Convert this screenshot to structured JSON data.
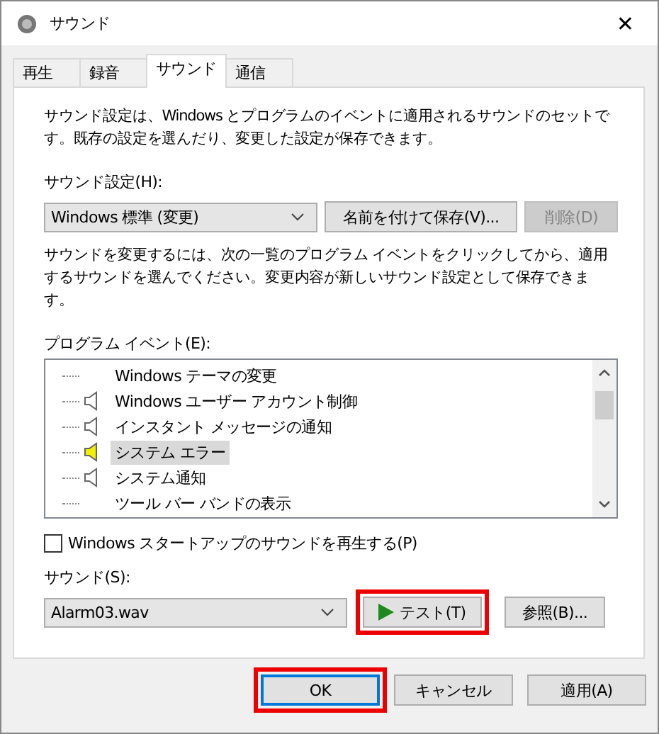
{
  "window": {
    "title": "サウンド",
    "close": "✕"
  },
  "tabs": [
    {
      "label": "再生",
      "selected": false
    },
    {
      "label": "録音",
      "selected": false
    },
    {
      "label": "サウンド",
      "selected": true
    },
    {
      "label": "通信",
      "selected": false
    }
  ],
  "intro": "サウンド設定は、Windows とプログラムのイベントに適用されるサウンドのセットです。既存の設定を選んだり、変更した設定が保存できます。",
  "scheme": {
    "label": "サウンド設定(H):",
    "value": "Windows 標準 (変更)",
    "save_button": "名前を付けて保存(V)...",
    "delete_button": {
      "label": "削除(D)",
      "disabled": true
    }
  },
  "help": "サウンドを変更するには、次の一覧のプログラム イベントをクリックしてから、適用するサウンドを選んでください。変更内容が新しいサウンド設定として保存できます。",
  "events": {
    "label": "プログラム イベント(E):",
    "items": [
      {
        "label": "Windows テーマの変更",
        "has_sound": false,
        "selected": false
      },
      {
        "label": "Windows ユーザー アカウント制御",
        "has_sound": true,
        "selected": false
      },
      {
        "label": "インスタント メッセージの通知",
        "has_sound": true,
        "selected": false
      },
      {
        "label": "システム エラー",
        "has_sound": true,
        "selected": true
      },
      {
        "label": "システム通知",
        "has_sound": true,
        "selected": false
      },
      {
        "label": "ツール バー バンドの表示",
        "has_sound": false,
        "selected": false
      }
    ]
  },
  "startup": {
    "label": "Windows スタートアップのサウンドを再生する(P)",
    "checked": false
  },
  "sound": {
    "label": "サウンド(S):",
    "value": "Alarm03.wav",
    "test_button": {
      "label": "テスト(T)",
      "highlighted": true
    },
    "browse_button": {
      "label": "参照(B)...",
      "highlighted": false
    }
  },
  "buttons": [
    {
      "label": "OK",
      "default": true,
      "highlighted": true
    },
    {
      "label": "キャンセル",
      "default": false,
      "highlighted": false
    },
    {
      "label": "適用(A)",
      "default": false,
      "highlighted": false
    }
  ]
}
